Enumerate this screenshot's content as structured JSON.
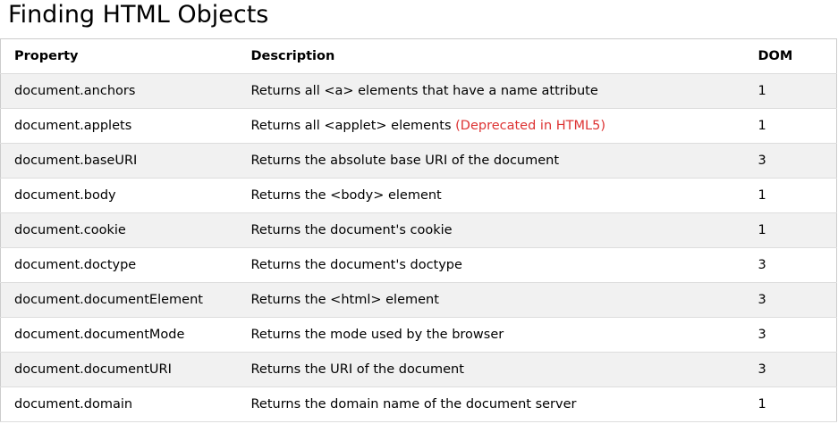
{
  "page": {
    "title": "Finding HTML Objects"
  },
  "table": {
    "headers": {
      "property": "Property",
      "description": "Description",
      "dom": "DOM"
    },
    "rows": [
      {
        "property": "document.anchors",
        "description": "Returns all <a> elements that have a name attribute",
        "note": "",
        "dom": "1"
      },
      {
        "property": "document.applets",
        "description": "Returns all <applet> elements ",
        "note": "(Deprecated in HTML5)",
        "dom": "1"
      },
      {
        "property": "document.baseURI",
        "description": "Returns the absolute base URI of the document",
        "note": "",
        "dom": "3"
      },
      {
        "property": "document.body",
        "description": "Returns the <body> element",
        "note": "",
        "dom": "1"
      },
      {
        "property": "document.cookie",
        "description": "Returns the document's cookie",
        "note": "",
        "dom": "1"
      },
      {
        "property": "document.doctype",
        "description": "Returns the document's doctype",
        "note": "",
        "dom": "3"
      },
      {
        "property": "document.documentElement",
        "description": "Returns the <html> element",
        "note": "",
        "dom": "3"
      },
      {
        "property": "document.documentMode",
        "description": "Returns the mode used by the browser",
        "note": "",
        "dom": "3"
      },
      {
        "property": "document.documentURI",
        "description": "Returns the URI of the document",
        "note": "",
        "dom": "3"
      },
      {
        "property": "document.domain",
        "description": "Returns the domain name of the document server",
        "note": "",
        "dom": "1"
      }
    ]
  },
  "colors": {
    "deprecated_note": "#dd3333",
    "odd_row_bg": "#f1f1f1"
  }
}
